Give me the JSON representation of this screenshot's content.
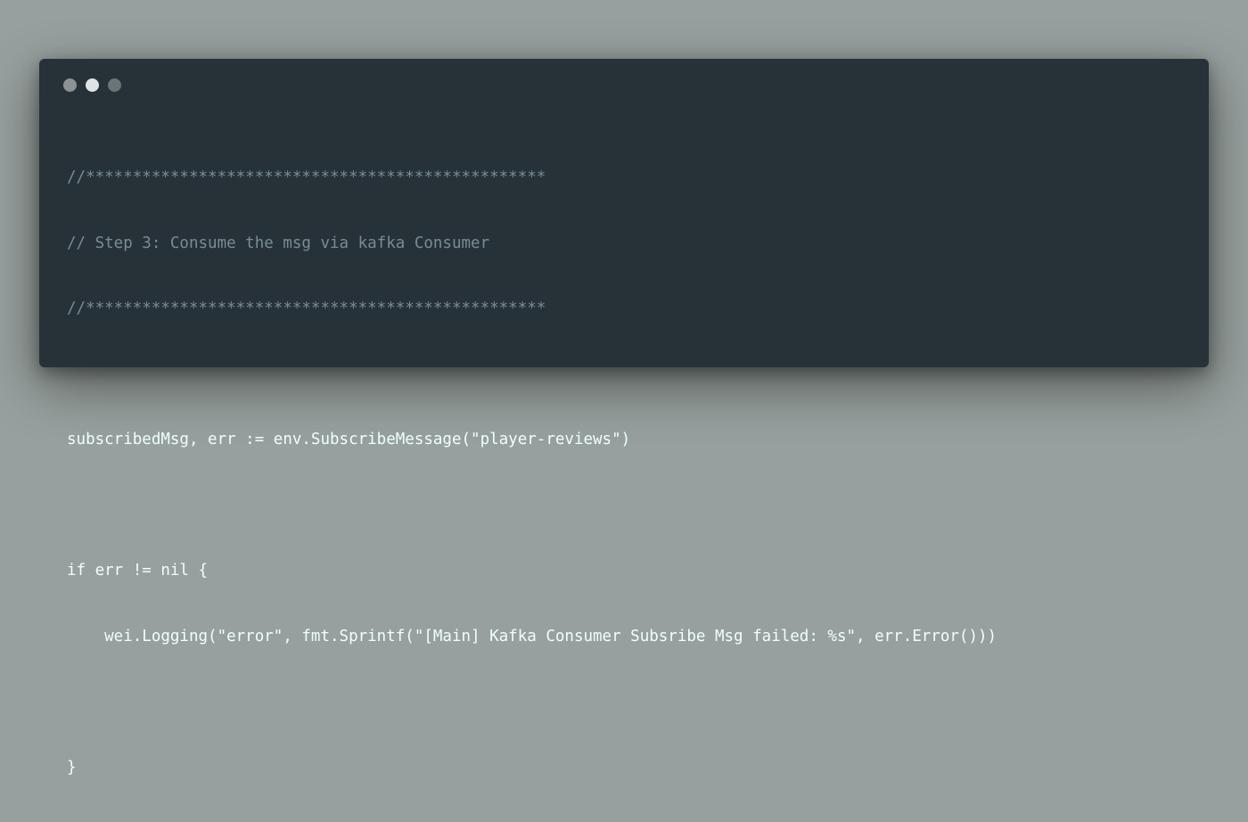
{
  "window": {
    "controls": [
      "close",
      "minimize",
      "zoom"
    ]
  },
  "code": {
    "lines": [
      {
        "text": "//*************************************************",
        "kind": "comment"
      },
      {
        "text": "// Step 3: Consume the msg via kafka Consumer",
        "kind": "comment"
      },
      {
        "text": "//*************************************************",
        "kind": "comment"
      },
      {
        "text": "",
        "kind": "blank"
      },
      {
        "text": "subscribedMsg, err := env.SubscribeMessage(\"player-reviews\")",
        "kind": "code"
      },
      {
        "text": "",
        "kind": "blank"
      },
      {
        "text": "if err != nil {",
        "kind": "code"
      },
      {
        "text": "    wei.Logging(\"error\", fmt.Sprintf(\"[Main] Kafka Consumer Subsribe Msg failed: %s\", err.Error()))",
        "kind": "code"
      },
      {
        "text": "",
        "kind": "blank"
      },
      {
        "text": "}",
        "kind": "code"
      }
    ]
  },
  "colors": {
    "background": "#97a09e",
    "window": "#263238",
    "text": "#eeffff",
    "comment": "#7a8b94"
  }
}
